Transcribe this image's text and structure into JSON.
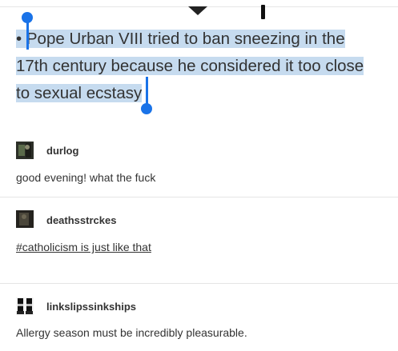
{
  "quote": {
    "lines": [
      "• Pope Urban VIII tried to ban sneezing in the",
      "17th century because he considered it too close",
      "to sexual ecstasy"
    ]
  },
  "posts": [
    {
      "username": "durlog",
      "text": "good evening! what the fuck",
      "avatar_icon": "avatar-dark-photo"
    },
    {
      "username": "deathsstrckes",
      "text": "#catholicism is just like that",
      "avatar_icon": "avatar-dark-photo"
    },
    {
      "username": "linkslipssinkships",
      "text": "Allergy season must be incredibly pleasurable.",
      "avatar_icon": "avatar-boots-photo"
    }
  ],
  "colors": {
    "selection": "#c6dbef",
    "handle": "#1a73e8"
  }
}
